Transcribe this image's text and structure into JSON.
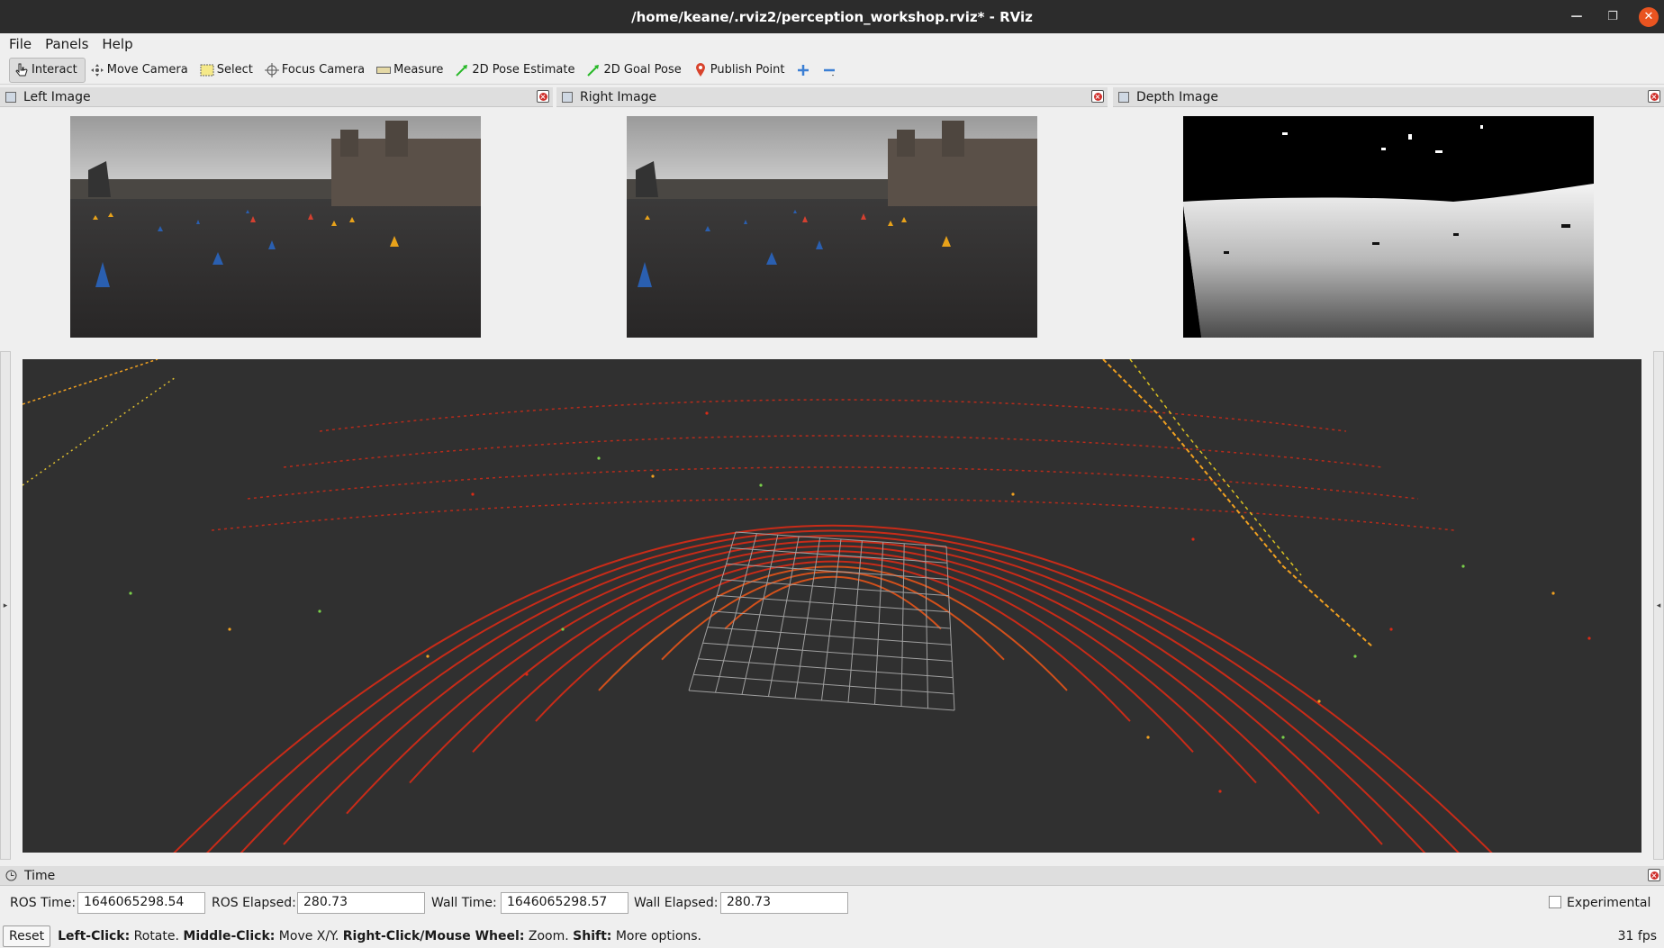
{
  "window": {
    "title": "/home/keane/.rviz2/perception_workshop.rviz* - RViz"
  },
  "menu": [
    "File",
    "Panels",
    "Help"
  ],
  "toolbar": {
    "tools": [
      {
        "label": "Interact",
        "icon": "cursor-hand-icon",
        "active": true
      },
      {
        "label": "Move Camera",
        "icon": "move-camera-icon"
      },
      {
        "label": "Select",
        "icon": "select-box-icon"
      },
      {
        "label": "Focus Camera",
        "icon": "focus-crosshair-icon"
      },
      {
        "label": "Measure",
        "icon": "ruler-icon"
      },
      {
        "label": "2D Pose Estimate",
        "icon": "green-arrow-icon"
      },
      {
        "label": "2D Goal Pose",
        "icon": "green-arrow-icon"
      },
      {
        "label": "Publish Point",
        "icon": "map-pin-icon"
      }
    ],
    "add_tool_icon": "plus-icon",
    "remove_tool_icon": "minus-icon"
  },
  "image_panels": [
    {
      "title": "Left Image",
      "kind": "camera"
    },
    {
      "title": "Right Image",
      "kind": "camera"
    },
    {
      "title": "Depth Image",
      "kind": "depth"
    }
  ],
  "time_panel": {
    "title": "Time",
    "ros_time_label": "ROS Time:",
    "ros_time": "1646065298.54",
    "ros_elapsed_label": "ROS Elapsed:",
    "ros_elapsed": "280.73",
    "wall_time_label": "Wall Time:",
    "wall_time": "1646065298.57",
    "wall_elapsed_label": "Wall Elapsed:",
    "wall_elapsed": "280.73",
    "experimental_label": "Experimental",
    "experimental_checked": false
  },
  "status": {
    "reset_label": "Reset",
    "hints": [
      {
        "key": "Left-Click:",
        "text": " Rotate. "
      },
      {
        "key": "Middle-Click:",
        "text": " Move X/Y. "
      },
      {
        "key": "Right-Click/Mouse Wheel:",
        "text": " Zoom. "
      },
      {
        "key": "Shift:",
        "text": " More options."
      }
    ],
    "fps": "31 fps"
  },
  "colors": {
    "view_background": "#303030",
    "lidar_near": "#d92b16",
    "lidar_far": "#f0a020",
    "grid": "#a0a0a0",
    "close_button": "#d0312d"
  }
}
